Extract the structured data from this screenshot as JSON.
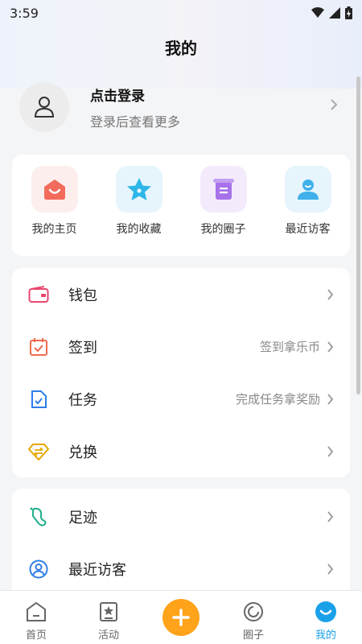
{
  "status_bar": {
    "time": "3:59"
  },
  "header": {
    "title": "我的"
  },
  "profile": {
    "login_title": "点击登录",
    "login_sub": "登录后查看更多"
  },
  "quick_links": [
    {
      "label": "我的主页",
      "icon": "home-face-icon",
      "color": "#f26b5b",
      "bg": "#fdeeee"
    },
    {
      "label": "我的收藏",
      "icon": "star-icon",
      "color": "#2fb6e9",
      "bg": "#e6f5fc"
    },
    {
      "label": "我的圈子",
      "icon": "scroll-icon",
      "color": "#a772ea",
      "bg": "#f3ebfc"
    },
    {
      "label": "最近访客",
      "icon": "visitor-icon",
      "color": "#3fb0ea",
      "bg": "#e6f4fc"
    }
  ],
  "menu_group_1": [
    {
      "label": "钱包",
      "hint": "",
      "icon": "wallet-icon"
    },
    {
      "label": "签到",
      "hint": "签到拿乐币",
      "icon": "calendar-check-icon"
    },
    {
      "label": "任务",
      "hint": "完成任务拿奖励",
      "icon": "task-check-icon"
    },
    {
      "label": "兑换",
      "hint": "",
      "icon": "exchange-diamond-icon"
    }
  ],
  "menu_group_2": [
    {
      "label": "足迹",
      "hint": "",
      "icon": "footprint-icon"
    },
    {
      "label": "最近访客",
      "hint": "",
      "icon": "user-circle-icon"
    }
  ],
  "tabbar": [
    {
      "label": "首页",
      "icon": "home-tab-icon"
    },
    {
      "label": "活动",
      "icon": "activity-tab-icon"
    },
    {
      "label": "",
      "icon": "plus-icon"
    },
    {
      "label": "圈子",
      "icon": "circle-tab-icon"
    },
    {
      "label": "我的",
      "icon": "mine-tab-icon"
    }
  ],
  "colors": {
    "accent": "#1aa0e8",
    "plus": "#ffa31a"
  }
}
